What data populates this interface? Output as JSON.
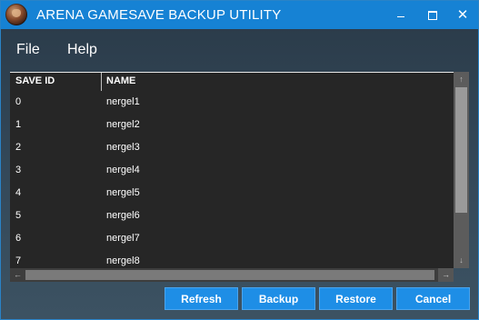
{
  "window": {
    "title": "ARENA GAMESAVE BACKUP UTILITY",
    "controls": {
      "minimize": "",
      "maximize": "",
      "close": "✕"
    }
  },
  "menu": {
    "items": [
      {
        "label": "File"
      },
      {
        "label": "Help"
      }
    ]
  },
  "grid": {
    "columns": [
      {
        "label": "SAVE ID"
      },
      {
        "label": "NAME"
      }
    ],
    "rows": [
      {
        "id": "0",
        "name": "nergel1"
      },
      {
        "id": "1",
        "name": "nergel2"
      },
      {
        "id": "2",
        "name": "nergel3"
      },
      {
        "id": "3",
        "name": "nergel4"
      },
      {
        "id": "4",
        "name": "nergel5"
      },
      {
        "id": "5",
        "name": "nergel6"
      },
      {
        "id": "6",
        "name": "nergel7"
      },
      {
        "id": "7",
        "name": "nergel8"
      }
    ],
    "scroll_arrows": {
      "up": "↑",
      "down": "↓",
      "left": "←",
      "right": "→"
    }
  },
  "buttons": {
    "refresh": "Refresh",
    "backup": "Backup",
    "restore": "Restore",
    "cancel": "Cancel"
  },
  "colors": {
    "titlebar": "#1682d4",
    "accent_button": "#1e8ee6",
    "grid_background": "#262626"
  },
  "icons": {
    "app": "arena-app-icon",
    "minimize": "minimize-icon",
    "maximize": "maximize-icon",
    "close": "close-icon"
  }
}
